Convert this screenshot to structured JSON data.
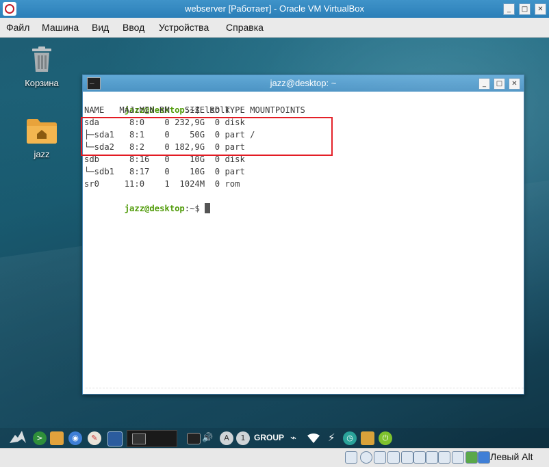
{
  "window": {
    "title": "webserver [Работает] - Oracle VM VirtualBox"
  },
  "menubar": {
    "items": [
      "Файл",
      "Машина",
      "Вид",
      "Ввод",
      "Устройства",
      "Справка"
    ]
  },
  "desktop": {
    "icons": [
      {
        "label": "Корзина",
        "icon": "trash-icon"
      },
      {
        "label": "jazz",
        "icon": "home-folder-icon"
      }
    ]
  },
  "terminal": {
    "title": "jazz@desktop: ~",
    "prompt_user": "jazz@desktop",
    "prompt_suffix": ":~$",
    "command": " lsblk",
    "header": "NAME   MAJ:MIN RM   SIZE RO TYPE MOUNTPOINTS",
    "rows": [
      "sda      8:0    0 232,9G  0 disk",
      "├─sda1   8:1    0    50G  0 part /",
      "└─sda2   8:2    0 182,9G  0 part",
      "sdb      8:16   0    10G  0 disk",
      "└─sdb1   8:17   0    10G  0 part",
      "sr0     11:0    1  1024M  0 rom"
    ]
  },
  "panel": {
    "keyboard_label": "GROUP"
  },
  "statusbar": {
    "host_key": "Левый Alt"
  },
  "colors": {
    "prompt_green": "#4e9a06",
    "highlight_red": "#e31b23",
    "vb_title_blue": "#2b7fb8"
  }
}
